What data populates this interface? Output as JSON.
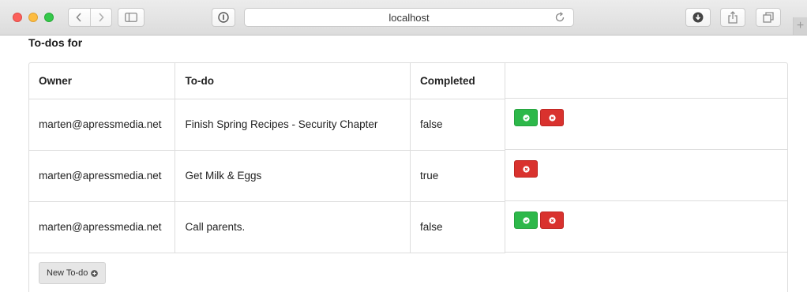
{
  "browser": {
    "url": "localhost"
  },
  "page": {
    "title": "To-dos for"
  },
  "table": {
    "headers": {
      "owner": "Owner",
      "todo": "To-do",
      "completed": "Completed"
    },
    "rows": [
      {
        "owner": "marten@apressmedia.net",
        "todo": "Finish Spring Recipes - Security Chapter",
        "completed": "false",
        "show_complete_button": true
      },
      {
        "owner": "marten@apressmedia.net",
        "todo": "Get Milk & Eggs",
        "completed": "true",
        "show_complete_button": false
      },
      {
        "owner": "marten@apressmedia.net",
        "todo": "Call parents.",
        "completed": "false",
        "show_complete_button": true
      }
    ]
  },
  "new_todo_button": {
    "label": "New To-do"
  },
  "colors": {
    "complete_button": "#2db84a",
    "delete_button": "#d9322e"
  }
}
